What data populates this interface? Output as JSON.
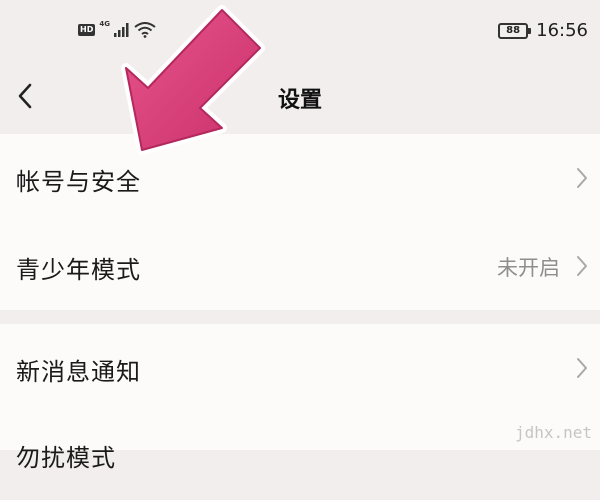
{
  "status_bar": {
    "hd": "HD",
    "network": "4G",
    "battery": "88",
    "time": "16:56"
  },
  "header": {
    "title": "设置"
  },
  "settings": [
    {
      "label": "帐号与安全",
      "value": ""
    },
    {
      "label": "青少年模式",
      "value": "未开启"
    },
    {
      "label": "新消息通知",
      "value": ""
    },
    {
      "label": "勿扰模式",
      "value": ""
    }
  ],
  "watermark": "jdhx.net",
  "colors": {
    "background": "#f2eeee",
    "card": "#fdfafa",
    "arrow": "#d9427a",
    "secondary_text": "#8e8e8e"
  },
  "icons": [
    "back-chevron-icon",
    "chevron-right-icon",
    "signal-icon",
    "wifi-icon",
    "battery-icon",
    "pointer-arrow-icon"
  ]
}
